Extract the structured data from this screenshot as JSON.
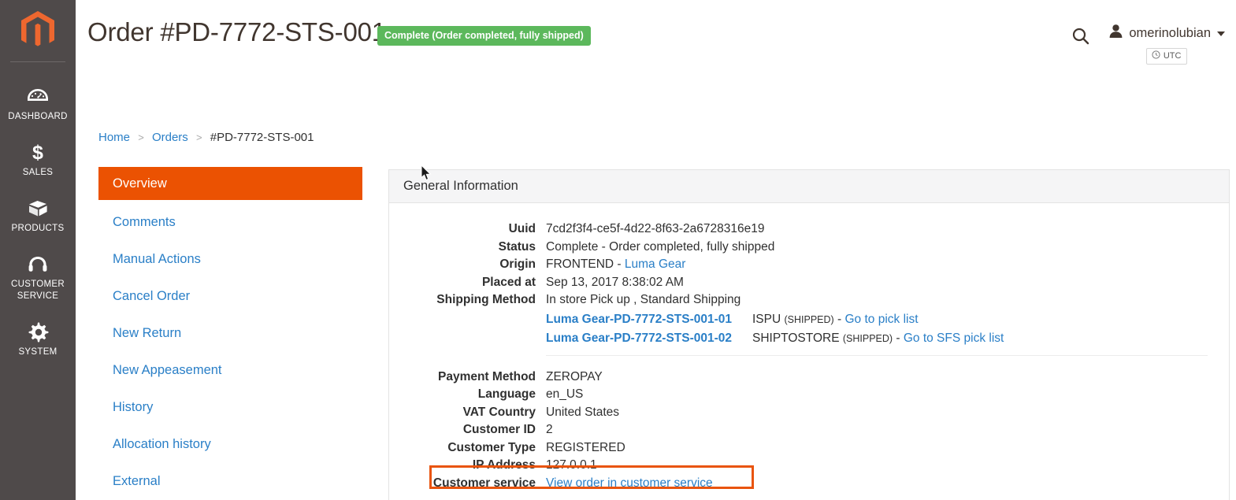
{
  "sidebar": {
    "logo_name": "magento-logo",
    "items": [
      {
        "icon": "dashboard-gauge-icon",
        "label": "DASHBOARD"
      },
      {
        "icon": "sales-dollar-icon",
        "label": "SALES"
      },
      {
        "icon": "products-box-icon",
        "label": "PRODUCTS"
      },
      {
        "icon": "customer-service-headset-icon",
        "label": "CUSTOMER SERVICE"
      },
      {
        "icon": "system-gear-icon",
        "label": "SYSTEM"
      }
    ]
  },
  "header": {
    "title": "Order #PD-7772-STS-001",
    "status_badge": "Complete (Order completed, fully shipped)",
    "status_badge_color": "#5cb85c",
    "search_icon": "search-icon",
    "user_icon": "user-avatar-icon",
    "user_name": "omerinolubian",
    "timezone_icon": "clock-icon",
    "timezone_label": "UTC"
  },
  "breadcrumb": {
    "home": "Home",
    "orders": "Orders",
    "separator": ">",
    "current": "#PD-7772-STS-001"
  },
  "order_nav": {
    "active_color": "#eb5202",
    "items": [
      {
        "label": "Overview",
        "active": true
      },
      {
        "label": "Comments",
        "active": false
      },
      {
        "label": "Manual Actions",
        "active": false
      },
      {
        "label": "Cancel Order",
        "active": false
      },
      {
        "label": "New Return",
        "active": false
      },
      {
        "label": "New Appeasement",
        "active": false
      },
      {
        "label": "History",
        "active": false
      },
      {
        "label": "Allocation history",
        "active": false
      },
      {
        "label": "External",
        "active": false
      }
    ]
  },
  "general_information": {
    "panel_title": "General Information",
    "rows": [
      {
        "label": "Uuid",
        "value": "7cd2f3f4-ce5f-4d22-8f63-2a6728316e19"
      },
      {
        "label": "Status",
        "value": "Complete - Order completed, fully shipped"
      },
      {
        "label": "Origin",
        "value": "FRONTEND - ",
        "link": "Luma Gear"
      },
      {
        "label": "Placed at",
        "value": "Sep 13, 2017 8:38:02 AM"
      },
      {
        "label": "Shipping Method",
        "value": "In store Pick up , Standard Shipping"
      }
    ],
    "shipments": [
      {
        "name": "Luma Gear-PD-7772-STS-001-01",
        "type": "ISPU",
        "state": "(SHIPPED)",
        "dash": " - ",
        "link": "Go to pick list"
      },
      {
        "name": "Luma Gear-PD-7772-STS-001-02",
        "type": "SHIPTOSTORE",
        "state": "(SHIPPED)",
        "dash": " - ",
        "link": "Go to SFS pick list"
      }
    ],
    "rows2": [
      {
        "label": "Payment Method",
        "value": "ZEROPAY"
      },
      {
        "label": "Language",
        "value": "en_US"
      },
      {
        "label": "VAT Country",
        "value": "United States"
      },
      {
        "label": "Customer ID",
        "value": "2"
      },
      {
        "label": "Customer Type",
        "value": "REGISTERED"
      },
      {
        "label": "IP Address",
        "value": "127.0.0.1"
      }
    ],
    "customer_service": {
      "label": "Customer service",
      "link": "View order in customer service",
      "highlight_color": "#e9540e"
    }
  }
}
